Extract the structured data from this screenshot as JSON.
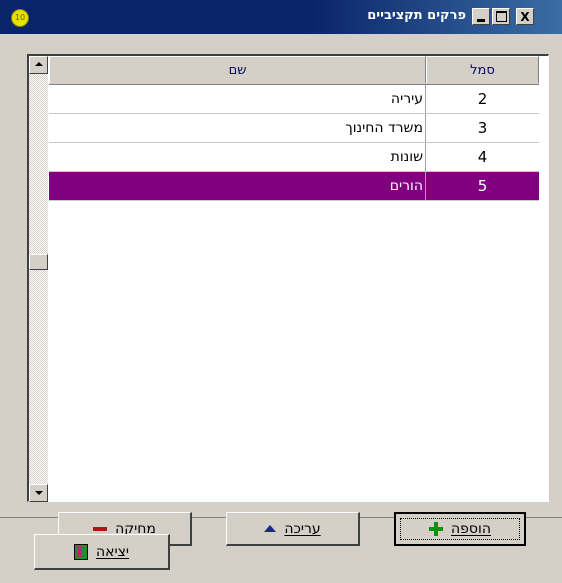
{
  "window": {
    "title": "פרקים תקציביים",
    "icon": "app-circle-icon",
    "controls": {
      "close": "X",
      "maximize": "maximize-icon",
      "minimize": "minimize-icon"
    }
  },
  "table": {
    "columns": {
      "name": "שם",
      "code": "סמל"
    },
    "rows": [
      {
        "code": "2",
        "name": "עיריה"
      },
      {
        "code": "3",
        "name": "משרד החינוך"
      },
      {
        "code": "4",
        "name": "שונות"
      },
      {
        "code": "5",
        "name": "הורים"
      }
    ],
    "selected_row_index": 3,
    "selected_color": "#800080"
  },
  "buttons": {
    "delete": "מחיקה",
    "edit": "עריכה",
    "add": "הוספה",
    "exit": "יציאה"
  }
}
